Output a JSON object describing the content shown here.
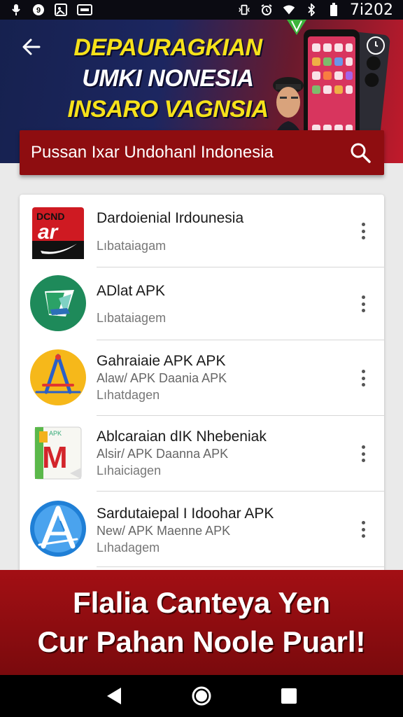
{
  "status_bar": {
    "time": "7i202",
    "left_icons": [
      "mic-icon",
      "notification-icon",
      "image-icon",
      "cast-icon"
    ],
    "right_icons": [
      "vibrate-icon",
      "alarm-icon",
      "wifi-icon",
      "bluetooth-icon",
      "battery-icon"
    ]
  },
  "hero": {
    "line1": "DEPAURAGKIAN",
    "line2": "UMKI NONESIA",
    "line3": "INSARO VAGNSIA"
  },
  "search": {
    "text": "Pussan Ixar Undohanl Indonesia"
  },
  "apps": [
    {
      "title": "Dardoienial Irdounesia",
      "subtitle": "",
      "meta": "Lıbataiagam",
      "icon": "nike-app-icon"
    },
    {
      "title": "ADlat APK",
      "subtitle": "",
      "meta": "Lıbataiagem",
      "icon": "green-leaf-app-icon"
    },
    {
      "title": "Gahraiaie APK APK",
      "subtitle": "Alaw/ APK Daania APK",
      "meta": "Lıhatdagen",
      "icon": "compass-app-icon"
    },
    {
      "title": "Ablcaraian dIK Nhebeniak",
      "subtitle": "Alsir/ APK Daanna APK",
      "meta": "Lıhaiciagen",
      "icon": "m-letter-app-icon"
    },
    {
      "title": "Sardutaiepal I Idoohar APK",
      "subtitle": "New/ APK Maenne APK",
      "meta": "Lıhadagem",
      "icon": "a-letter-app-icon"
    }
  ],
  "promo": {
    "line1": "Flalia Canteya Yen",
    "line2": "Cur Pahan Noole Puarl!"
  },
  "colors": {
    "accent": "#8e0d10",
    "hero_yellow": "#f6e21a"
  }
}
